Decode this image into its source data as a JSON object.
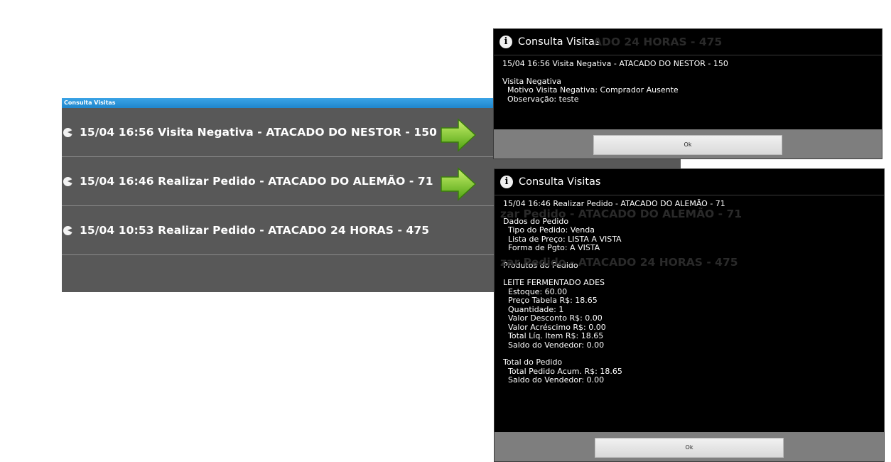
{
  "list": {
    "title": "Consulta Visitas",
    "rows": [
      {
        "text": "15/04 16:56 Visita Negativa - ATACADO DO NESTOR - 150"
      },
      {
        "text": "15/04 16:46 Realizar Pedido - ATACADO DO ALEMÃO - 71"
      },
      {
        "text": "15/04 10:53 Realizar Pedido - ATACADO 24 HORAS - 475"
      }
    ]
  },
  "dialog1": {
    "title": "Consulta Visitas",
    "ghost": "ADO 24 HORAS - 475",
    "lines": [
      "15/04 16:56 Visita Negativa - ATACADO DO NESTOR - 150",
      "",
      "Visita Negativa",
      "  Motivo Visita Negativa: Comprador Ausente",
      "  Observação: teste"
    ],
    "ok_label": "Ok"
  },
  "dialog2": {
    "title": "Consulta Visitas",
    "ghost1": "zar Pedido - ATACADO DO ALEMÃO - 71",
    "ghost2": "zar Pedido - ATACADO 24 HORAS - 475",
    "lines": [
      "15/04 16:46 Realizar Pedido - ATACADO DO ALEMÃO - 71",
      "",
      "Dados do Pedido",
      "  Tipo do Pedido: Venda",
      "  Lista de Preço: LISTA A VISTA",
      "  Forma de Pgto: A VISTA",
      "",
      "Produtos do Pedido",
      "",
      "LEITE FERMENTADO ADES",
      "  Estoque: 60.00",
      "  Preço Tabela R$: 18.65",
      "  Quantidade: 1",
      "  Valor Desconto R$: 0.00",
      "  Valor Acréscimo R$: 0.00",
      "  Total Líq. Item R$: 18.65",
      "  Saldo do Vendedor: 0.00",
      "",
      "Total do Pedido",
      "  Total Pedido Acum. R$: 18.65",
      "  Saldo do Vendedor: 0.00"
    ],
    "ok_label": "Ok"
  },
  "colors": {
    "list_background": "#585858",
    "titlebar": "#2f95d8",
    "dialog_background": "#000000",
    "arrow_green": "#7ccf2a"
  },
  "icons": {
    "row_icon": "back-arrow-circle-icon",
    "dialog_icon": "info-icon",
    "arrow": "green-right-arrow-icon"
  }
}
